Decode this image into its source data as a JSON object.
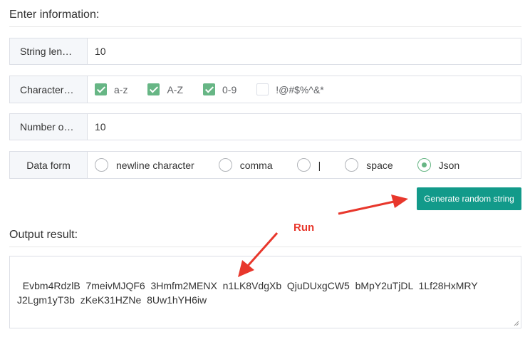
{
  "form": {
    "title": "Enter information:",
    "string_length": {
      "label": "String len…",
      "value": "10"
    },
    "characters": {
      "label": "Character…",
      "options": [
        {
          "label": "a-z",
          "checked": true
        },
        {
          "label": "A-Z",
          "checked": true
        },
        {
          "label": "0-9",
          "checked": true
        },
        {
          "label": "!@#$%^&*",
          "checked": false
        }
      ]
    },
    "number_of": {
      "label": "Number o…",
      "value": "10"
    },
    "data_form": {
      "label": "Data form",
      "options": [
        {
          "label": "newline character",
          "checked": false
        },
        {
          "label": "comma",
          "checked": false
        },
        {
          "label": "|",
          "checked": false
        },
        {
          "label": "space",
          "checked": false
        },
        {
          "label": "Json",
          "checked": true
        }
      ]
    },
    "generate_label": "Generate random string"
  },
  "output": {
    "title": "Output result:",
    "text": "Evbm4RdzlB  7meivMJQF6  3Hmfm2MENX  n1LK8VdgXb  QjuDUxgCW5  bMpY2uTjDL  1Lf28HxMRY\nJ2Lgm1yT3b  zKeK31HZNe  8Uw1hYH6iw"
  },
  "annotation": {
    "text": "Run",
    "color": "#e8372c"
  },
  "colors": {
    "accent": "#67b685",
    "button": "#129a8a"
  }
}
